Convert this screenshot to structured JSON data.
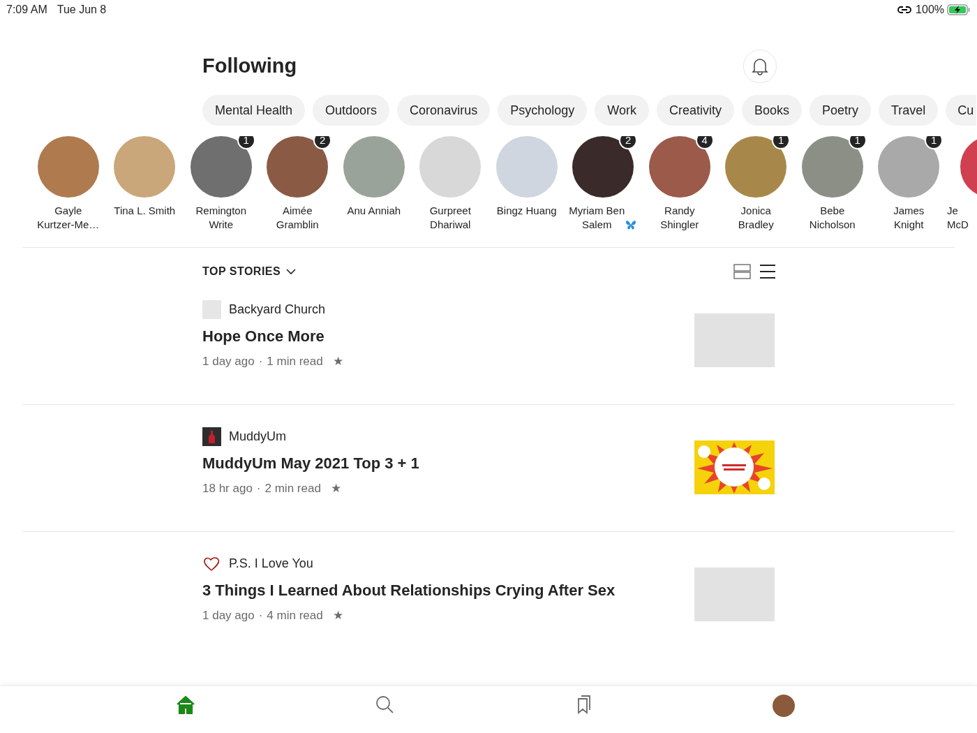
{
  "status_bar": {
    "time": "7:09 AM",
    "date": "Tue Jun 8",
    "battery": "100%"
  },
  "header": {
    "title": "Following"
  },
  "topics": [
    {
      "label": "Mental Health"
    },
    {
      "label": "Outdoors"
    },
    {
      "label": "Coronavirus"
    },
    {
      "label": "Psychology"
    },
    {
      "label": "Work"
    },
    {
      "label": "Creativity"
    },
    {
      "label": "Books"
    },
    {
      "label": "Poetry"
    },
    {
      "label": "Travel"
    },
    {
      "label": "Cu"
    }
  ],
  "following": [
    {
      "lines": [
        "Gayle",
        "Kurtzer-Me…"
      ]
    },
    {
      "lines": [
        "Tina L. Smith"
      ]
    },
    {
      "lines": [
        "Remington",
        "Write"
      ],
      "badge": "1"
    },
    {
      "lines": [
        "Aimée",
        "Gramblin"
      ],
      "badge": "2"
    },
    {
      "lines": [
        "Anu Anniah"
      ]
    },
    {
      "lines": [
        "Gurpreet",
        "Dhariwal"
      ]
    },
    {
      "lines": [
        "Bingz Huang"
      ]
    },
    {
      "lines": [
        "Myriam Ben",
        "Salem"
      ],
      "badge": "2",
      "butterfly": true
    },
    {
      "lines": [
        "Randy",
        "Shingler"
      ],
      "badge": "4"
    },
    {
      "lines": [
        "Jonica",
        "Bradley"
      ],
      "badge": "1"
    },
    {
      "lines": [
        "Bebe",
        "Nicholson"
      ],
      "badge": "1"
    },
    {
      "lines": [
        "James",
        "Knight"
      ],
      "badge": "1"
    },
    {
      "lines": [
        "Je",
        "McD"
      ]
    }
  ],
  "feed": {
    "heading": "TOP STORIES"
  },
  "stories": [
    {
      "publication": "Backyard Church",
      "logo": {
        "kind": "blank"
      },
      "title": "Hope Once More",
      "age": "1 day ago",
      "separator": "·",
      "read": "1 min read",
      "star": "★",
      "thumbnail": {
        "kind": "blank"
      }
    },
    {
      "publication": "MuddyUm",
      "logo": {
        "kind": "bottle"
      },
      "title": "MuddyUm May 2021 Top 3 + 1",
      "age": "18 hr ago",
      "separator": "·",
      "read": "2 min read",
      "star": "★",
      "thumbnail": {
        "kind": "comic"
      }
    },
    {
      "publication": "P.S. I Love You",
      "logo": {
        "kind": "heart"
      },
      "title": "3 Things I Learned About Relationships Crying After Sex",
      "age": "1 day ago",
      "separator": "·",
      "read": "4 min read",
      "star": "★",
      "thumbnail": {
        "kind": "blank"
      }
    }
  ],
  "tab_bar": [
    {
      "kind": "home",
      "selected": true
    },
    {
      "kind": "search",
      "selected": false
    },
    {
      "kind": "bookmarks",
      "selected": false
    },
    {
      "kind": "profile",
      "selected": false
    }
  ]
}
